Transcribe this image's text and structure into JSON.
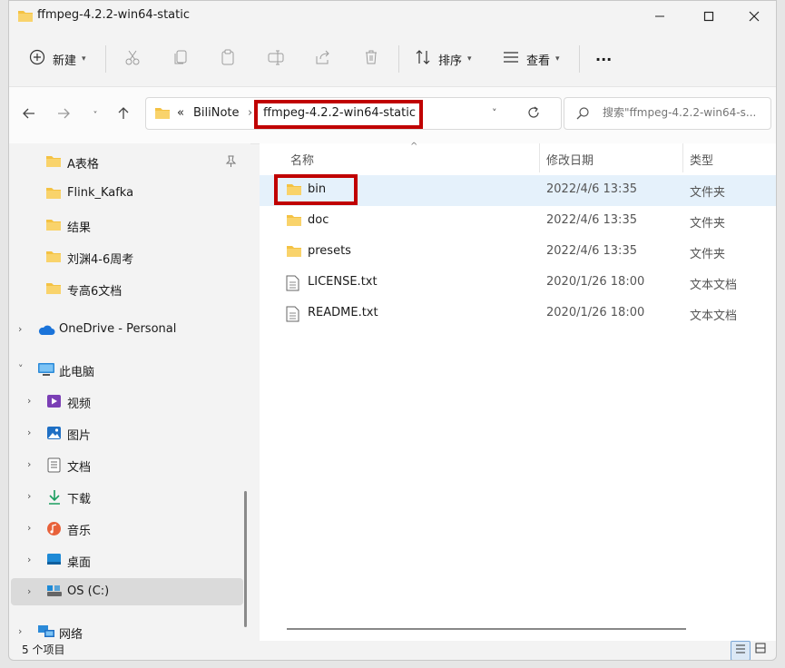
{
  "window": {
    "title": "ffmpeg-4.2.2-win64-static"
  },
  "toolbar": {
    "new_label": "新建",
    "sort_label": "排序",
    "view_label": "查看",
    "more": "···"
  },
  "address": {
    "overflow": "«",
    "separator": "›",
    "crumbs": [
      "BiliNote",
      "ffmpeg-4.2.2-win64-static"
    ]
  },
  "search": {
    "placeholder": "搜索\"ffmpeg-4.2.2-win64-s..."
  },
  "sidebar": {
    "items": [
      {
        "label": "A表格",
        "icon": "folder-icon",
        "pinned": true
      },
      {
        "label": "Flink_Kafka",
        "icon": "folder-icon"
      },
      {
        "label": "结果",
        "icon": "folder-icon"
      },
      {
        "label": "刘渊4-6周考",
        "icon": "folder-icon"
      },
      {
        "label": "专高6文档",
        "icon": "folder-icon"
      },
      {
        "label": "OneDrive - Personal",
        "icon": "cloud-icon"
      },
      {
        "label": "此电脑",
        "icon": "computer-icon"
      },
      {
        "label": "视频",
        "icon": "video-icon"
      },
      {
        "label": "图片",
        "icon": "picture-icon"
      },
      {
        "label": "文档",
        "icon": "document-icon"
      },
      {
        "label": "下载",
        "icon": "download-icon"
      },
      {
        "label": "音乐",
        "icon": "music-icon"
      },
      {
        "label": "桌面",
        "icon": "desktop-icon"
      },
      {
        "label": "OS (C:)",
        "icon": "drive-icon"
      },
      {
        "label": "网络",
        "icon": "network-icon"
      }
    ]
  },
  "columns": {
    "name": "名称",
    "date": "修改日期",
    "type": "类型"
  },
  "files": [
    {
      "name": "bin",
      "date": "2022/4/6 13:35",
      "type": "文件夹",
      "icon": "folder-icon"
    },
    {
      "name": "doc",
      "date": "2022/4/6 13:35",
      "type": "文件夹",
      "icon": "folder-icon"
    },
    {
      "name": "presets",
      "date": "2022/4/6 13:35",
      "type": "文件夹",
      "icon": "folder-icon"
    },
    {
      "name": "LICENSE.txt",
      "date": "2020/1/26 18:00",
      "type": "文本文档",
      "icon": "text-file-icon"
    },
    {
      "name": "README.txt",
      "date": "2020/1/26 18:00",
      "type": "文本文档",
      "icon": "text-file-icon"
    }
  ],
  "status": {
    "count": "5 个项目"
  },
  "colors": {
    "folder": "#f4c243",
    "highlight": "#c00000",
    "selection": "#e5f1fb"
  }
}
